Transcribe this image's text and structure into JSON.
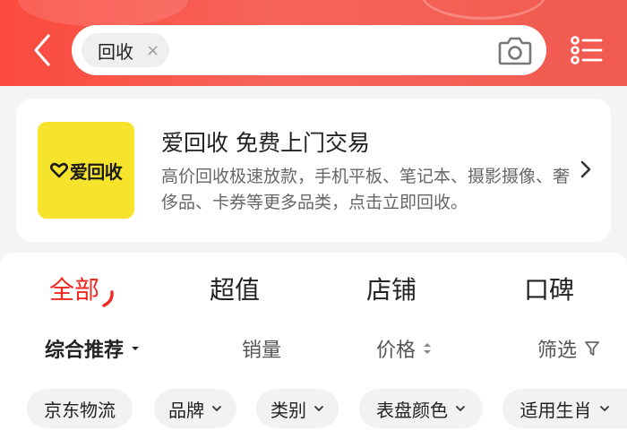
{
  "search": {
    "chip_label": "回收",
    "chip_close": "×"
  },
  "banner": {
    "logo_text": "爱回收",
    "title": "爱回收 免费上门交易",
    "description": "高价回收极速放款，手机平板、笔记本、摄影摄像、奢侈品、卡券等更多品类，点击立即回收。"
  },
  "tabs": [
    {
      "label": "全部",
      "active": true
    },
    {
      "label": "超值",
      "active": false
    },
    {
      "label": "店铺",
      "active": false
    },
    {
      "label": "口碑",
      "active": false
    }
  ],
  "sort_bar": {
    "comprehensive": "综合推荐",
    "sales": "销量",
    "price": "价格",
    "filter": "筛选"
  },
  "filter_chips": [
    {
      "label": "京东物流"
    },
    {
      "label": "品牌"
    },
    {
      "label": "类别"
    },
    {
      "label": "表盘颜色"
    },
    {
      "label": "适用生肖"
    }
  ],
  "colors": {
    "accent": "#f0281f",
    "header": "#f7655a",
    "logo_bg": "#f6e32b"
  }
}
